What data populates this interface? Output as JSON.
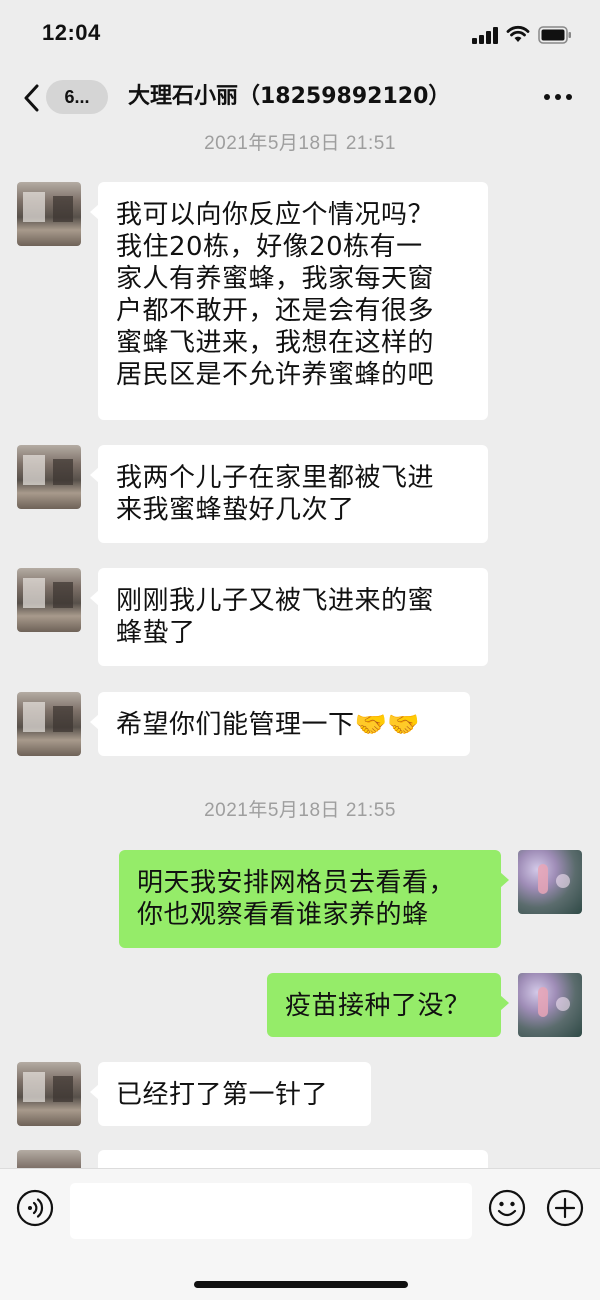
{
  "status_bar": {
    "time": "12:04",
    "icons": [
      "signal-icon",
      "wifi-icon",
      "battery-icon"
    ]
  },
  "nav": {
    "back_badge": "6...",
    "title": "大理石小丽（18259892120）",
    "icons": [
      "back-icon",
      "more-icon"
    ]
  },
  "chat": {
    "timestamps": [
      "2021年5月18日 21:51",
      "2021年5月18日 21:55"
    ],
    "messages": [
      {
        "side": "left",
        "text": "我可以向你反应个情况吗？\n我住20栋，好像20栋有一\n家人有养蜜蜂，我家每天窗\n户都不敢开，还是会有很多\n蜜蜂飞进来，我想在这样的\n居民区是不允许养蜜蜂的吧"
      },
      {
        "side": "left",
        "text": "我两个儿子在家里都被飞进\n来我蜜蜂蛰好几次了"
      },
      {
        "side": "left",
        "text": "刚刚我儿子又被飞进来的蜜\n蜂蛰了"
      },
      {
        "side": "left",
        "text": "希望你们能管理一下🤝🤝"
      },
      {
        "side": "right",
        "text": "明天我安排网格员去看看，\n你也观察看看谁家养的蜂"
      },
      {
        "side": "right",
        "text": "疫苗接种了没？"
      },
      {
        "side": "left",
        "text": "已经打了第一针了"
      }
    ]
  },
  "input_bar": {
    "placeholder": "",
    "icons": [
      "voice-icon",
      "emoji-icon",
      "plus-icon"
    ]
  },
  "colors": {
    "background": "#ededed",
    "bubble_self": "#95ec69",
    "bubble_other": "#ffffff",
    "timestamp": "#9e9e9e"
  }
}
